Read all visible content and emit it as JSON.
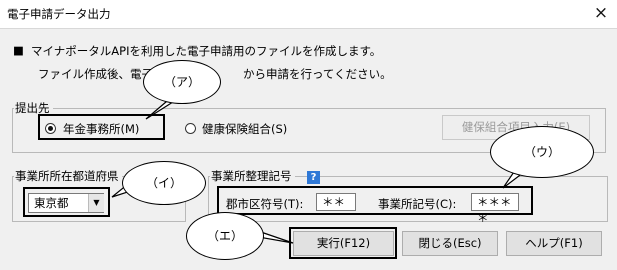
{
  "window": {
    "title": "電子申請データ出力",
    "close": "×"
  },
  "intro": {
    "bullet": "■",
    "line1": "マイナポータルAPIを利用した電子申請用のファイルを作成します。",
    "line2a": "ファイル作成後、電子申",
    "line2b": "から申請を行ってください。"
  },
  "submit_to": {
    "legend": "提出先",
    "options": [
      {
        "label": "年金事務所(M)",
        "selected": true
      },
      {
        "label": "健康保険組合(S)",
        "selected": false
      }
    ],
    "health_items_button": "健保組合項目入力(E)"
  },
  "prefecture": {
    "legend": "事業所所在都道府県",
    "value": "東京都"
  },
  "office_code": {
    "legend": "事業所整理記号",
    "help": "?",
    "city_label": "郡市区符号(T):",
    "city_value": "＊＊",
    "office_label": "事業所記号(C):",
    "office_value": "＊＊＊＊"
  },
  "buttons": {
    "run": "実行(F12)",
    "close": "閉じる(Esc)",
    "help": "ヘルプ(F1)"
  },
  "callouts": [
    "（ア）",
    "（イ）",
    "（ウ）",
    "（エ）"
  ]
}
